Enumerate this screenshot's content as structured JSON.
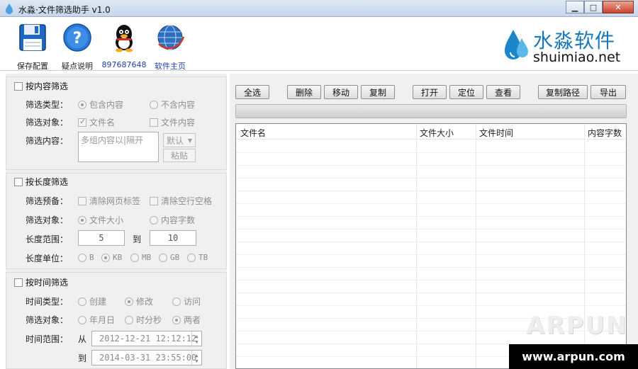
{
  "window": {
    "title": "水淼·文件筛选助手 v1.0",
    "buttons": [
      "minimize",
      "maximize",
      "close"
    ]
  },
  "toolbar": {
    "items": [
      {
        "label": "保存配置",
        "icon": "floppy-disk-icon"
      },
      {
        "label": "疑点说明",
        "icon": "help-icon"
      },
      {
        "label": "897687648",
        "icon": "qq-penguin-icon"
      },
      {
        "label": "软件主页",
        "icon": "globe-icon"
      }
    ],
    "brand_cn": "水淼软件",
    "brand_en": "shuimiao.net"
  },
  "content_filter": {
    "title": "按内容筛选",
    "type_label": "筛选类型：",
    "type_options": [
      "包含内容",
      "不含内容"
    ],
    "type_selected": "包含内容",
    "target_label": "筛选对象：",
    "target_options": [
      "文件名",
      "文件内容"
    ],
    "content_label": "筛选内容：",
    "content_placeholder": "多组内容以|隔开",
    "combo_value": "默认",
    "paste_label": "粘贴"
  },
  "length_filter": {
    "title": "按长度筛选",
    "prep_label": "筛选预备：",
    "prep_options": [
      "清除网页标签",
      "清除空行空格"
    ],
    "target_label": "筛选对象：",
    "target_options": [
      "文件大小",
      "内容字数"
    ],
    "target_selected": "文件大小",
    "range_label": "长度范围：",
    "range_from": "5",
    "range_to_label": "到",
    "range_to": "10",
    "unit_label": "长度单位：",
    "unit_options": [
      "B",
      "KB",
      "MB",
      "GB",
      "TB"
    ],
    "unit_selected": "KB"
  },
  "time_filter": {
    "title": "按时间筛选",
    "type_label": "时间类型：",
    "type_options": [
      "创建",
      "修改",
      "访问"
    ],
    "type_selected": "修改",
    "target_label": "筛选对象：",
    "target_options": [
      "年月日",
      "时分秒",
      "两者"
    ],
    "target_selected": "两者",
    "range_label": "时间范围：",
    "from_label": "从",
    "from_value": "2012-12-21 12:12:12",
    "to_label": "到",
    "to_value": "2014-03-31 23:55:00"
  },
  "actions": {
    "select_all": "全选",
    "delete": "删除",
    "move": "移动",
    "copy": "复制",
    "open": "打开",
    "locate": "定位",
    "view": "查看",
    "copy_path": "复制路径",
    "export": "导出"
  },
  "progress": {
    "value": 0
  },
  "table": {
    "columns": [
      "文件名",
      "文件大小",
      "文件时间",
      "内容字数"
    ],
    "rows": []
  },
  "watermark": {
    "big": "ARPUN",
    "url": "www.arpun.com"
  },
  "colors": {
    "brand_blue": "#1878b8",
    "qq_label_blue": "#1a3fa8",
    "titlebar": "#c6d6ea"
  }
}
